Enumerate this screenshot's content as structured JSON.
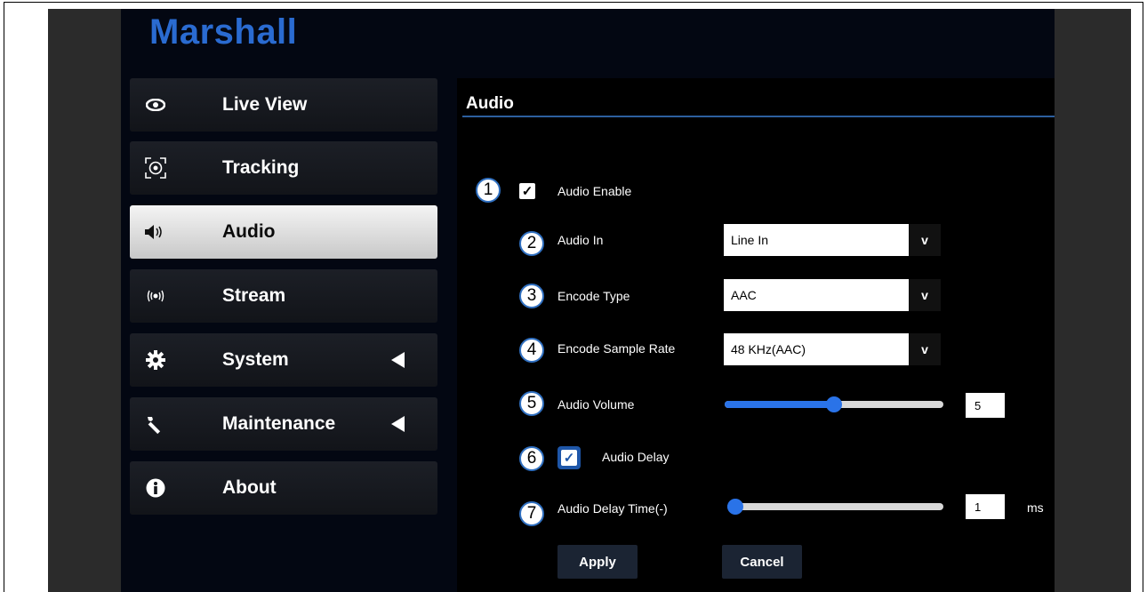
{
  "brand": {
    "name": "Marshall",
    "color": "#2a6bd1"
  },
  "sidebar": {
    "items": [
      {
        "label": "Live View",
        "icon": "eye-icon",
        "active": false,
        "has_arrow": false
      },
      {
        "label": "Tracking",
        "icon": "tracking-target-icon",
        "active": false,
        "has_arrow": false
      },
      {
        "label": "Audio",
        "icon": "speaker-icon",
        "active": true,
        "has_arrow": false
      },
      {
        "label": "Stream",
        "icon": "broadcast-icon",
        "active": false,
        "has_arrow": false
      },
      {
        "label": "System",
        "icon": "gear-icon",
        "active": false,
        "has_arrow": true
      },
      {
        "label": "Maintenance",
        "icon": "wrench-icon",
        "active": false,
        "has_arrow": true
      },
      {
        "label": "About",
        "icon": "info-icon",
        "active": false,
        "has_arrow": false
      }
    ]
  },
  "panel": {
    "title": "Audio",
    "audio_enable": {
      "badge": "1",
      "label": "Audio Enable",
      "checked": true
    },
    "audio_in": {
      "badge": "2",
      "label": "Audio In",
      "value": "Line In"
    },
    "encode_type": {
      "badge": "3",
      "label": "Encode Type",
      "value": "AAC"
    },
    "encode_sample_rate": {
      "badge": "4",
      "label": "Encode Sample Rate",
      "value": "48 KHz(AAC)"
    },
    "audio_volume": {
      "badge": "5",
      "label": "Audio Volume",
      "value": "5",
      "level_fraction": 0.5
    },
    "audio_delay": {
      "badge": "6",
      "label": "Audio Delay",
      "checked": true
    },
    "audio_delay_time": {
      "badge": "7",
      "label": "Audio Delay Time(-)",
      "value": "1",
      "unit": "ms",
      "level_fraction": 0.0
    },
    "apply_label": "Apply",
    "cancel_label": "Cancel",
    "dropdown_glyph": "v",
    "check_glyph": "✓"
  },
  "colors": {
    "accent": "#2a73e8",
    "badge_border": "#2f6fc0",
    "rule": "#2c5f9e"
  }
}
